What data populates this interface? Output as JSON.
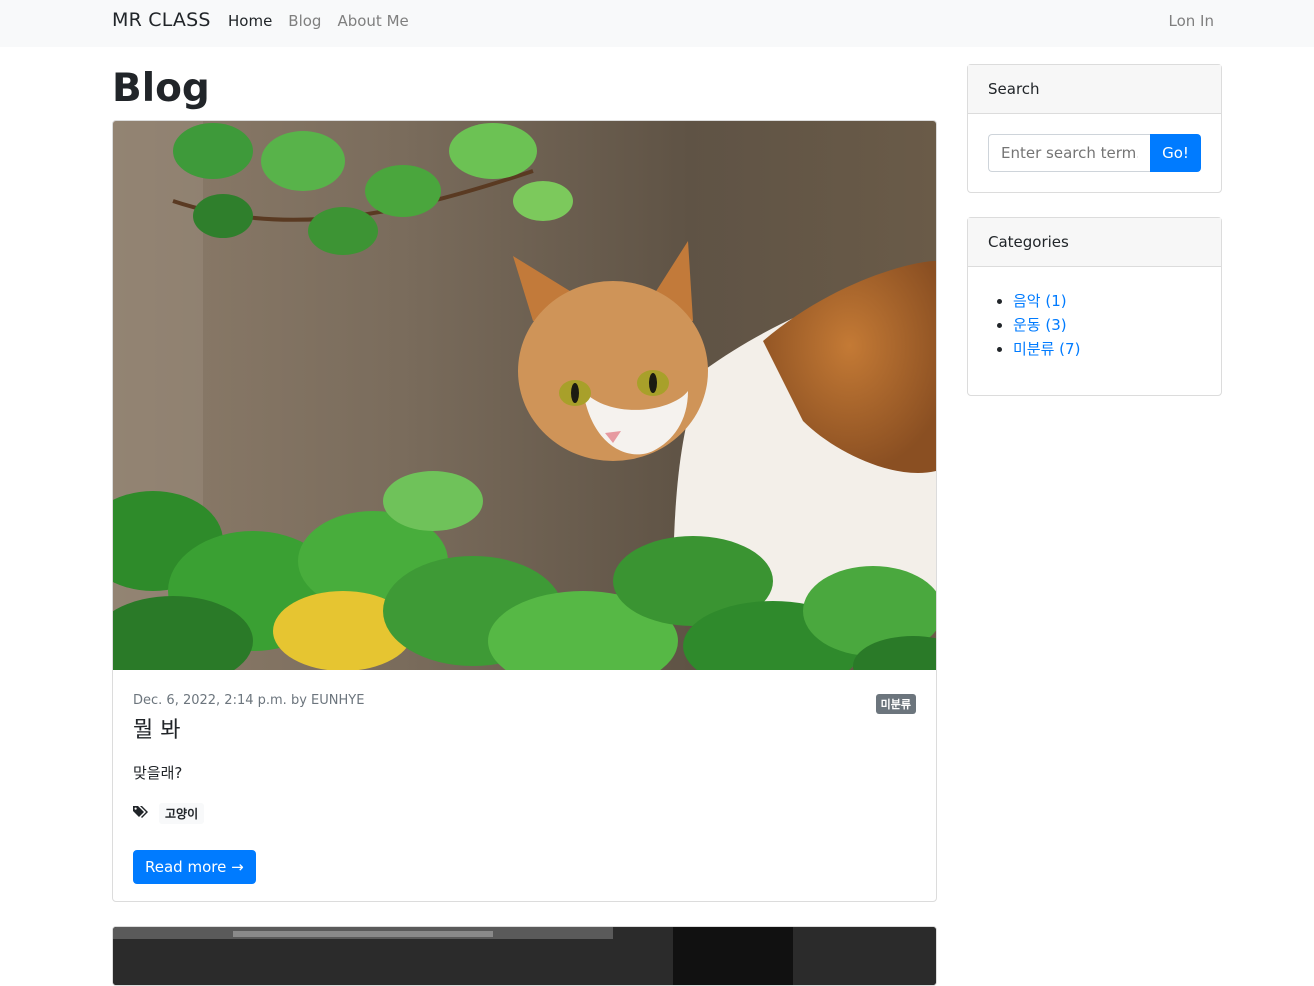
{
  "nav": {
    "brand": "MR CLASS",
    "links": [
      "Home",
      "Blog",
      "About Me"
    ],
    "login": "Lon In"
  },
  "page": {
    "title": "Blog"
  },
  "post": {
    "meta": "Dec. 6, 2022, 2:14 p.m. by EUNHYE",
    "category_badge": "미분류",
    "title": "뭘 봐",
    "excerpt": "맞을래?",
    "tags_icon": "tags-icon",
    "tags": [
      "고양이"
    ],
    "read_more": "Read more →"
  },
  "sidebar": {
    "search": {
      "header": "Search",
      "placeholder": "Enter search term...",
      "button": "Go!"
    },
    "categories": {
      "header": "Categories",
      "items": [
        "음악 (1)",
        "운동 (3)",
        "미분류 (7)"
      ]
    }
  },
  "colors": {
    "primary": "#007bff",
    "navbar_bg": "#f8f9fa",
    "badge": "#6c757d"
  }
}
